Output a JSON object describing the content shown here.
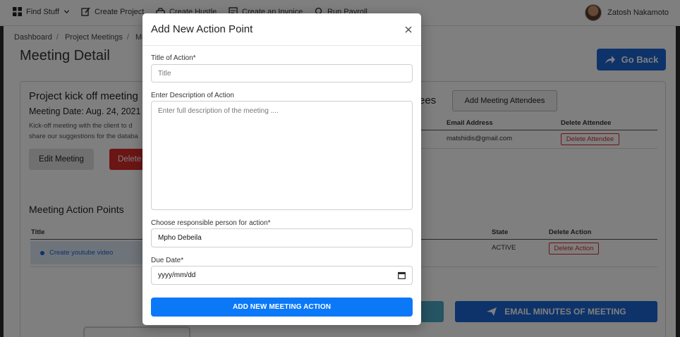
{
  "topnav": {
    "items": [
      {
        "label": "Find Stuff",
        "icon": "grid-icon"
      },
      {
        "label": "Create Project",
        "icon": "edit-icon"
      },
      {
        "label": "Create Hustle",
        "icon": "car-icon"
      },
      {
        "label": "Create an Invoice",
        "icon": "invoice-icon"
      },
      {
        "label": "Run Payroll",
        "icon": "location-icon"
      }
    ],
    "user_name": "Zatosh Nakamoto"
  },
  "breadcrumb": [
    "Dashboard",
    "Project Meetings",
    "Meeti"
  ],
  "page": {
    "title": "Meeting Detail",
    "go_back": "Go Back"
  },
  "meeting": {
    "title": "Project kick off meeting",
    "date": "Meeting Date: Aug. 24, 2021",
    "desc_line1": "Kick-off meeting with the client to d",
    "desc_line2": "share our suggestions for the databa",
    "edit_label": "Edit Meeting",
    "delete_label": "Delete"
  },
  "attendees": {
    "heading": "ees",
    "add_label": "Add Meeting Attendees",
    "columns": [
      "Email Address",
      "Delete Attendee"
    ],
    "rows": [
      {
        "email": "matshidis@gmail.com",
        "delete": "Delete Attendee"
      }
    ]
  },
  "action_points": {
    "heading": "Meeting Action Points",
    "columns": [
      "Title",
      "State",
      "Delete Action"
    ],
    "rows": [
      {
        "title": "Create youtube video",
        "state": "ACTIVE",
        "delete": "Delete Action"
      }
    ],
    "email_minutes": "EMAIL MINUTES OF MEETING"
  },
  "modal": {
    "title": "Add New Action Point",
    "title_label": "Title of Action*",
    "title_placeholder": "Title",
    "desc_label": "Enter Description of Action",
    "desc_placeholder": "Enter full description of the meeting ....",
    "person_label": "Choose responsible person for action*",
    "person_value": "Mpho Debeila",
    "due_label": "Due Date*",
    "due_placeholder": "yyyy/mm/dd",
    "submit_label": "ADD NEW MEETING ACTION"
  },
  "colors": {
    "primary": "#1b66d4",
    "submit": "#0b79f7",
    "danger": "#d72b2b"
  }
}
